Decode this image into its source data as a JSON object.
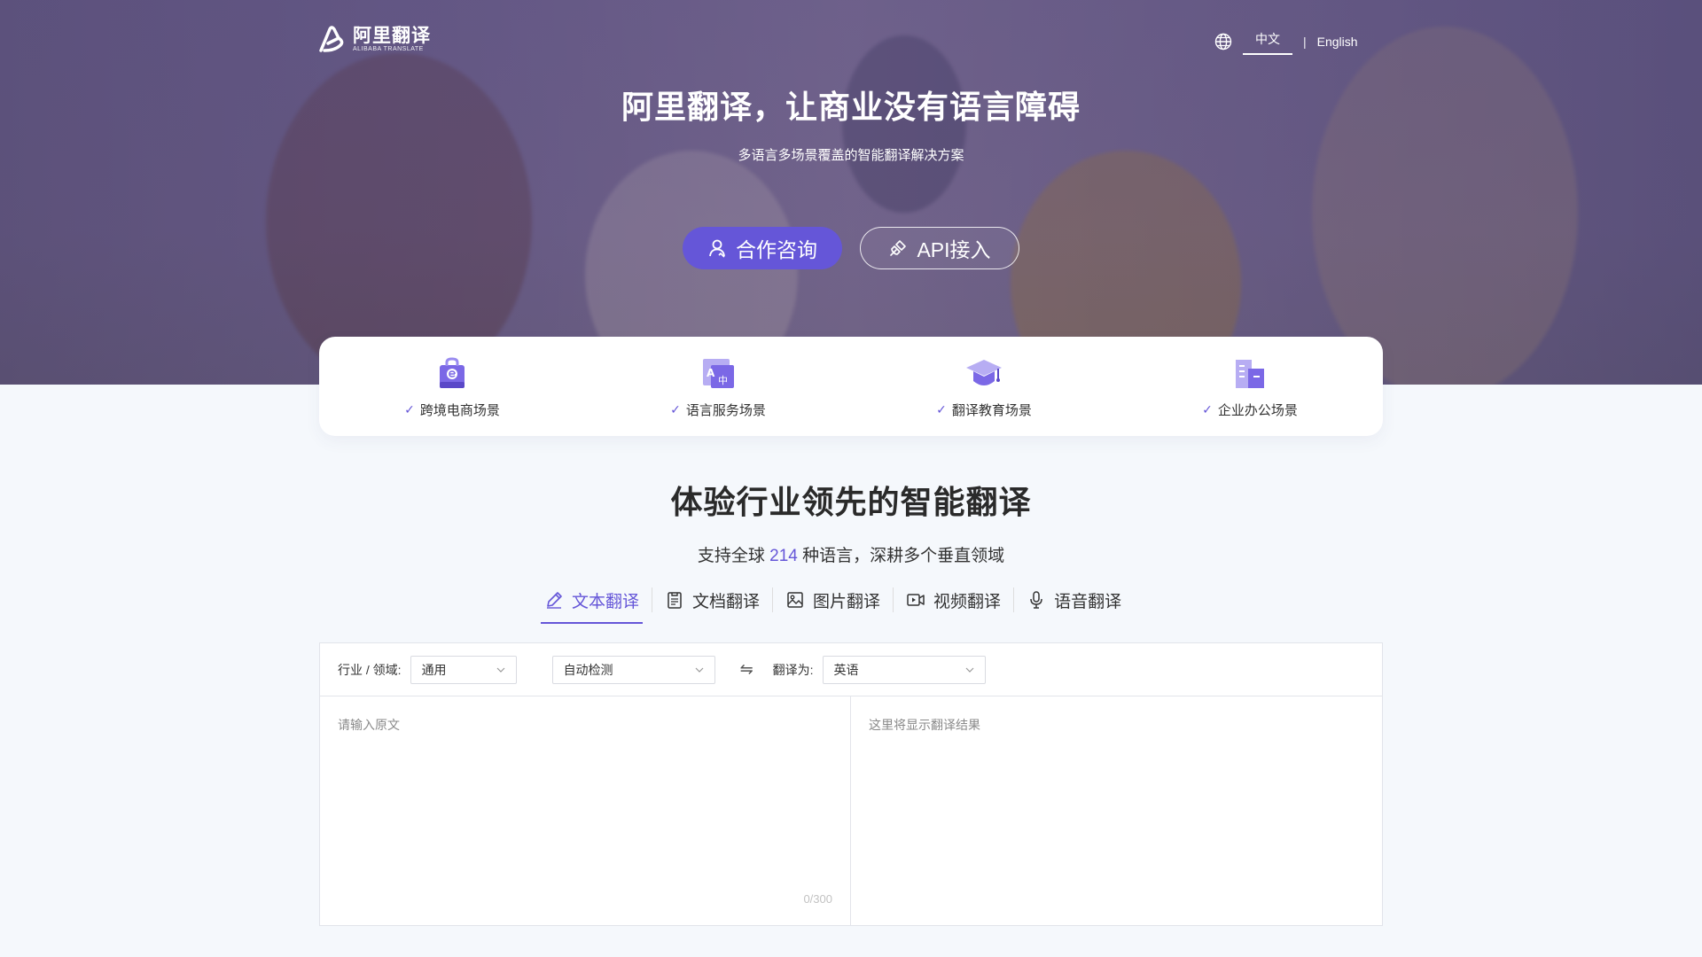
{
  "header": {
    "logo_cn": "阿里翻译",
    "logo_en": "ALIBABA TRANSLATE",
    "lang_zh": "中文",
    "lang_sep": "|",
    "lang_en": "English"
  },
  "hero": {
    "title": "阿里翻译，让商业没有语言障碍",
    "subtitle": "多语言多场景覆盖的智能翻译解决方案",
    "consult_label": "合作咨询",
    "api_label": "API接入"
  },
  "scenarios": [
    {
      "label": "跨境电商场景",
      "icon": "shopping-bag-icon"
    },
    {
      "label": "语言服务场景",
      "icon": "translate-icon"
    },
    {
      "label": "翻译教育场景",
      "icon": "graduation-cap-icon"
    },
    {
      "label": "企业办公场景",
      "icon": "office-building-icon"
    }
  ],
  "section": {
    "title": "体验行业领先的智能翻译",
    "sub_prefix": "支持全球",
    "sub_count": "214",
    "sub_suffix": "种语言，深耕多个垂直领域"
  },
  "tabs": [
    {
      "label": "文本翻译",
      "icon": "pencil-icon",
      "active": true
    },
    {
      "label": "文档翻译",
      "icon": "document-icon",
      "active": false
    },
    {
      "label": "图片翻译",
      "icon": "image-icon",
      "active": false
    },
    {
      "label": "视频翻译",
      "icon": "video-icon",
      "active": false
    },
    {
      "label": "语音翻译",
      "icon": "microphone-icon",
      "active": false
    }
  ],
  "translator": {
    "domain_label": "行业 / 领域:",
    "domain_value": "通用",
    "source_lang": "自动检测",
    "swap_symbol": "⇋",
    "target_label": "翻译为:",
    "target_lang": "英语",
    "source_placeholder": "请输入原文",
    "target_placeholder": "这里将显示翻译结果",
    "counter": "0/300"
  },
  "colors": {
    "accent": "#6556d8",
    "page_bg": "#f5f8fc"
  }
}
